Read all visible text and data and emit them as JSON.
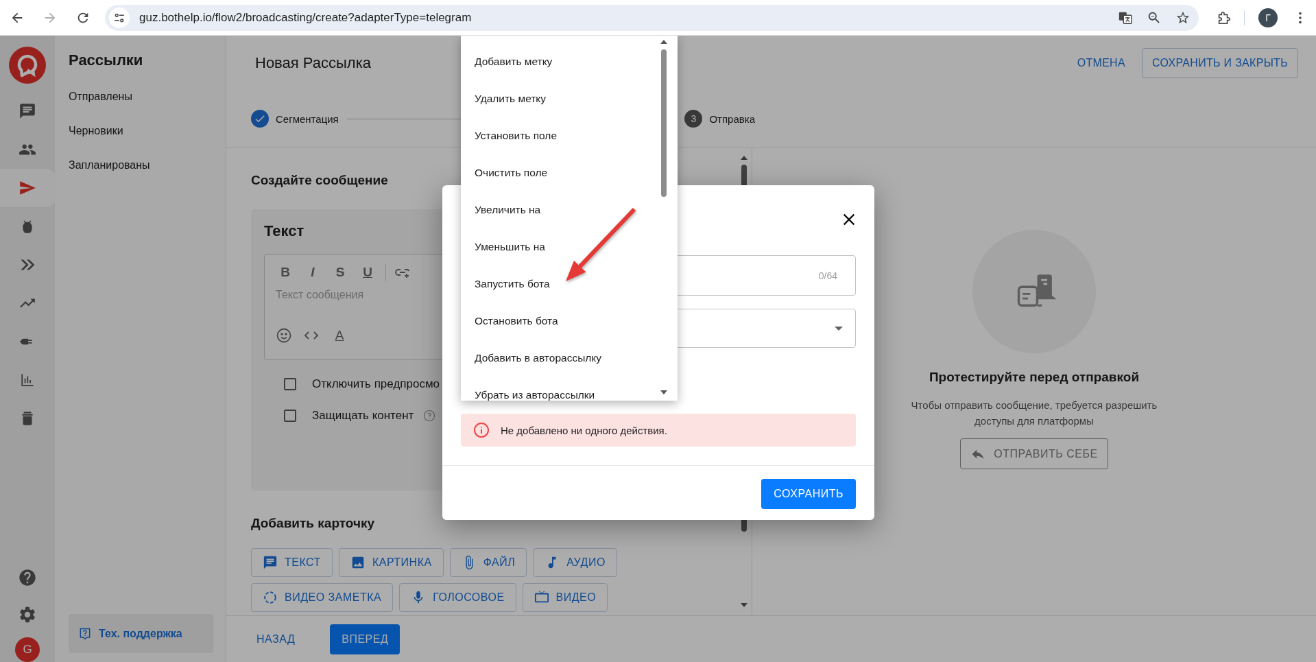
{
  "browser": {
    "url": "guz.bothelp.io/flow2/broadcasting/create?adapterType=telegram",
    "profile_initial": "Г"
  },
  "rail": {
    "items": [
      {
        "kind": "chat",
        "selected": false
      },
      {
        "kind": "contacts",
        "selected": false
      },
      {
        "kind": "send",
        "selected": true
      },
      {
        "kind": "bot",
        "selected": false
      },
      {
        "kind": "flows",
        "selected": false
      },
      {
        "kind": "growth",
        "selected": false
      },
      {
        "kind": "integrations",
        "selected": false
      },
      {
        "kind": "stats",
        "selected": false
      },
      {
        "kind": "archive",
        "selected": false
      }
    ],
    "user_initial": "G"
  },
  "sidebar": {
    "title": "Рассылки",
    "items": [
      "Отправлены",
      "Черновики",
      "Запланированы"
    ],
    "support": "Тех. поддержка"
  },
  "header": {
    "title": "Новая Рассылка",
    "cancel": "ОТМЕНА",
    "save_close": "СОХРАНИТЬ И ЗАКРЫТЬ"
  },
  "stepper": [
    {
      "label": "Сегментация",
      "completed": true
    },
    {
      "number": "3",
      "label": "Отправка",
      "completed": false
    }
  ],
  "editor": {
    "heading": "Создайте сообщение",
    "card_title": "Текст",
    "format_buttons": [
      {
        "kind": "bold",
        "label": "B"
      },
      {
        "kind": "italic",
        "label": "I"
      },
      {
        "kind": "strike",
        "label": "S"
      },
      {
        "kind": "underline",
        "label": "U"
      }
    ],
    "placeholder": "Текст сообщения",
    "color_button": "A",
    "options": [
      {
        "label": "Отключить предпросмо",
        "checked": false,
        "help": false
      },
      {
        "label": "Защищать контент",
        "checked": false,
        "help": true
      }
    ]
  },
  "add_card": {
    "heading": "Добавить карточку",
    "buttons": [
      {
        "kind": "text",
        "label": "ТЕКСТ"
      },
      {
        "kind": "image",
        "label": "КАРТИНКА"
      },
      {
        "kind": "file",
        "label": "ФАЙЛ"
      },
      {
        "kind": "audio",
        "label": "АУДИО"
      },
      {
        "kind": "video_note",
        "label": "ВИДЕО ЗАМЕТКА"
      },
      {
        "kind": "voice",
        "label": "ГОЛОСОВОЕ"
      },
      {
        "kind": "video",
        "label": "ВИДЕО"
      }
    ]
  },
  "footer": {
    "back": "НАЗАД",
    "next": "ВПЕРЕД"
  },
  "test_panel": {
    "title": "Протестируйте перед отправкой",
    "text": "Чтобы отправить сообщение, требуется разрешить доступы для платформы",
    "button": "ОТПРАВИТЬ СЕБЕ"
  },
  "modal": {
    "counter": "0/64",
    "alert": "Не добавлено ни одного действия.",
    "save": "СОХРАНИТЬ"
  },
  "dropdown": {
    "items": [
      "Добавить метку",
      "Удалить метку",
      "Установить поле",
      "Очистить поле",
      "Увеличить на",
      "Уменьшить на",
      "Запустить бота",
      "Остановить бота",
      "Добавить в авторассылку",
      "Убрать из авторассылки"
    ]
  }
}
